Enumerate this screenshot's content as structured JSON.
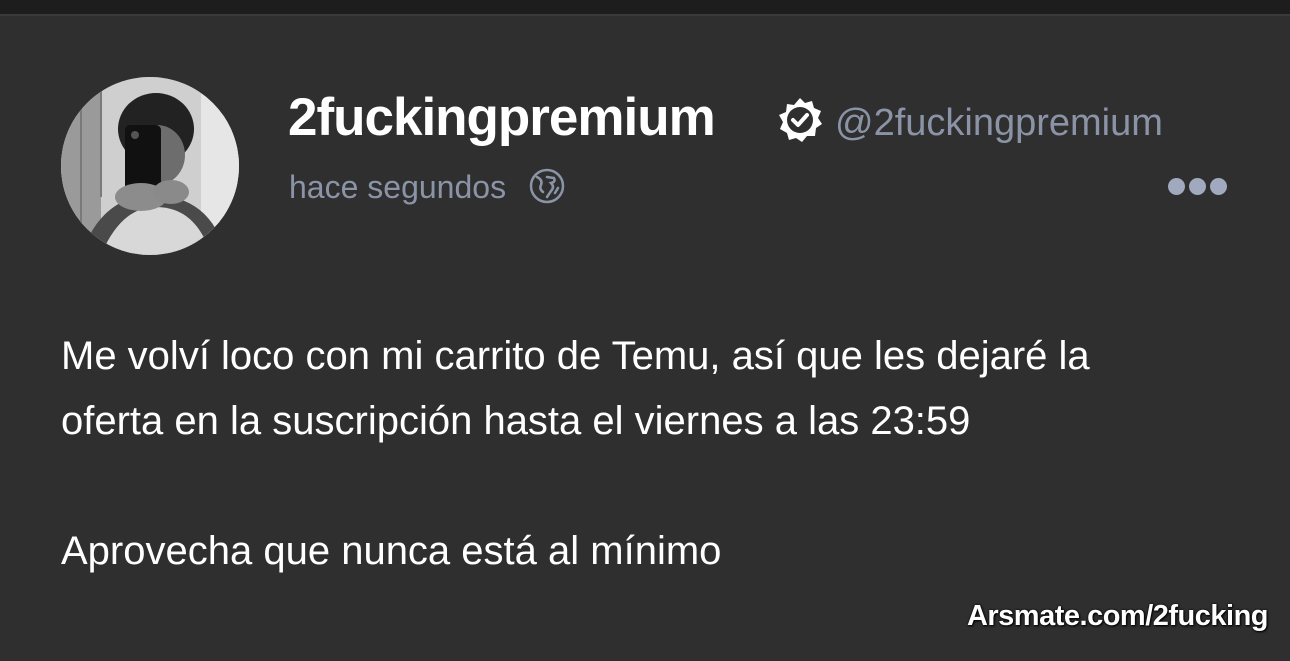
{
  "post": {
    "display_name": "2fuckingpremium",
    "handle": "@2fuckingpremium",
    "timestamp": "hace segundos",
    "verified_icon": "verified-badge-icon",
    "visibility_icon": "globe-icon",
    "more_icon": "more-dots-icon",
    "body": {
      "line1": "Me volví loco con mi carrito de Temu, así que les dejaré la",
      "line2": "oferta en la suscripción hasta el viernes a las 23:59",
      "line3": "Aprovecha que nunca está al mínimo"
    }
  },
  "watermark": {
    "text": "Arsmate.com/2fucking"
  },
  "colors": {
    "background": "#2f2f30",
    "text": "#ffffff",
    "muted": "#8b94a6",
    "dots": "#a0a9bd"
  }
}
